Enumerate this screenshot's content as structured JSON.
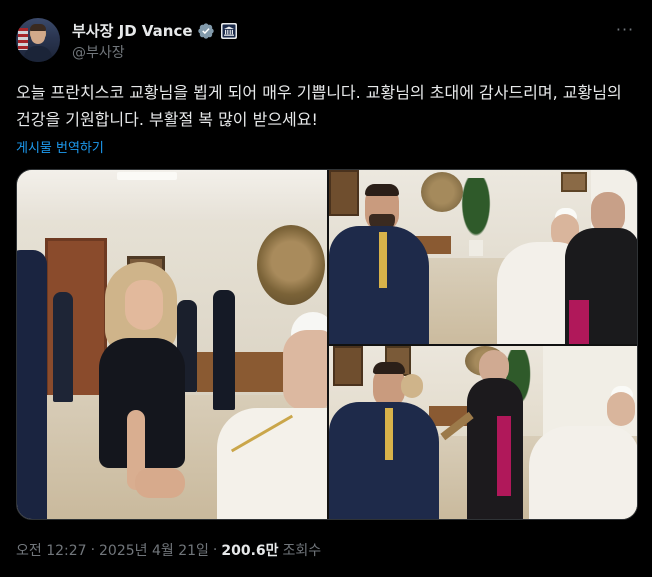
{
  "user": {
    "display_name": "부사장 JD Vance",
    "handle": "@부사장",
    "verified_icon": "verified-badge-icon",
    "gov_icon": "government-building-icon"
  },
  "more_label": "···",
  "tweet": {
    "text": "오늘 프란치스코 교황님을 뵙게 되어 매우 기쁩니다. 교황님의 초대에 감사드리며, 교황님의 건강을 기원합니다. 부활절 복 많이 받으세요!",
    "translate_label": "게시물 번역하기"
  },
  "meta": {
    "time": "오전 12:27",
    "separator1": "·",
    "date": "2025년 4월 21일",
    "separator2": "·",
    "views_count": "200.6만",
    "views_label": "조회수"
  },
  "colors": {
    "background": "#000000",
    "text": "#e7e9ea",
    "secondary": "#71767b",
    "link": "#1d9bf0",
    "verified": "#829aab"
  }
}
